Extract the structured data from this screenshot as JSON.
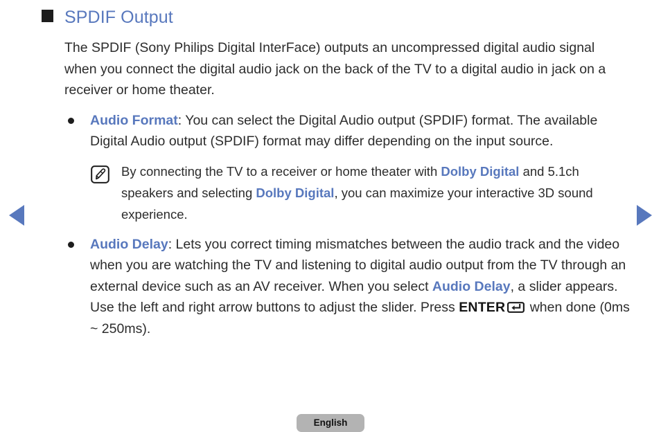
{
  "nav": {
    "prev_label": "previous page",
    "next_label": "next page"
  },
  "section": {
    "title": "SPDIF Output",
    "intro": "The SPDIF (Sony Philips Digital InterFace) outputs an uncompressed digital audio signal when you connect the digital audio jack on the back of the TV to a digital audio in jack on a receiver or home theater."
  },
  "bullets": [
    {
      "term": "Audio Format",
      "separator": ": ",
      "text": "You can select the Digital Audio output (SPDIF) format. The available Digital Audio output (SPDIF) format may differ depending on the input source."
    }
  ],
  "note": {
    "icon": "note-pencil-icon",
    "part1": "By connecting the TV to a receiver or home theater with ",
    "kw1": "Dolby Digital",
    "part2": " and 5.1ch speakers and selecting ",
    "kw2": "Dolby Digital",
    "part3": ", you can maximize your interactive 3D sound experience."
  },
  "delay_bullet": {
    "term": "Audio Delay",
    "separator": ": ",
    "part1": "Lets you correct timing mismatches between the audio track and the video when you are watching the TV and listening to digital audio output from the TV through an external device such as an AV receiver. When you select ",
    "kw1": "Audio Delay",
    "part2": ", a slider appears. Use the left and right arrow buttons to adjust the slider. Press ",
    "enter_label": "ENTER",
    "enter_icon": "enter-key-icon",
    "part3": " when done (0ms ~ 250ms)."
  },
  "footer": {
    "language": "English"
  },
  "colors": {
    "accent_blue": "#5878bd",
    "body_text": "#2c2c2c",
    "marker_black": "#1d1d1d",
    "button_gray": "#b3b3b3"
  }
}
